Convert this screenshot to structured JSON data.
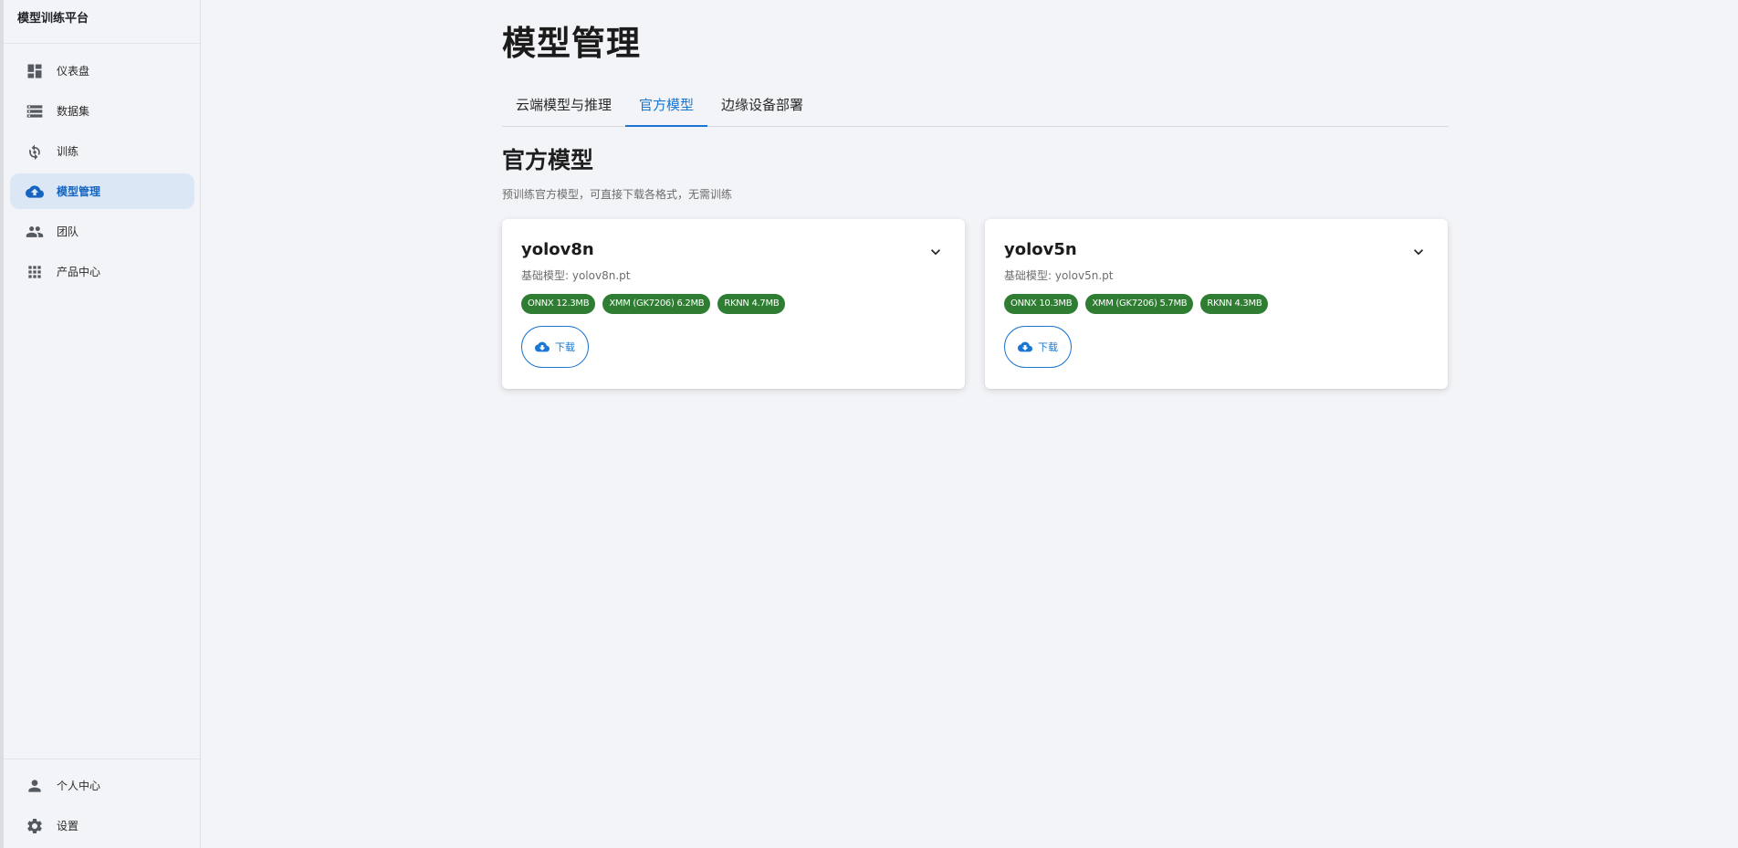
{
  "app": {
    "brand": "模型训练平台"
  },
  "sidebar": {
    "items": [
      {
        "label": "仪表盘",
        "icon": "dashboard-icon",
        "active": false
      },
      {
        "label": "数据集",
        "icon": "storage-list-icon",
        "active": false
      },
      {
        "label": "训练",
        "icon": "training-cycle-icon",
        "active": false
      },
      {
        "label": "模型管理",
        "icon": "cloud-upload-icon",
        "active": true
      },
      {
        "label": "团队",
        "icon": "people-icon",
        "active": false
      },
      {
        "label": "产品中心",
        "icon": "apps-grid-icon",
        "active": false
      }
    ],
    "bottom": [
      {
        "label": "个人中心",
        "icon": "person-icon"
      },
      {
        "label": "设置",
        "icon": "gear-icon"
      }
    ]
  },
  "main": {
    "title": "模型管理",
    "tabs": [
      {
        "label": "云端模型与推理",
        "active": false
      },
      {
        "label": "官方模型",
        "active": true
      },
      {
        "label": "边缘设备部署",
        "active": false
      }
    ],
    "section_title": "官方模型",
    "section_desc": "预训练官方模型，可直接下载各格式，无需训练",
    "cards": [
      {
        "name": "yolov8n",
        "base_model": "基础模型: yolov8n.pt",
        "formats": [
          "ONNX 12.3MB",
          "XMM (GK7206) 6.2MB",
          "RKNN 4.7MB"
        ],
        "download_label": "下载"
      },
      {
        "name": "yolov5n",
        "base_model": "基础模型: yolov5n.pt",
        "formats": [
          "ONNX 10.3MB",
          "XMM (GK7206) 5.7MB",
          "RKNN 4.3MB"
        ],
        "download_label": "下载"
      }
    ]
  },
  "colors": {
    "accent": "#1976d2",
    "active_nav_bg": "#dce7f6",
    "chip_green": "#2e7d32",
    "background": "#f3f4f7"
  }
}
